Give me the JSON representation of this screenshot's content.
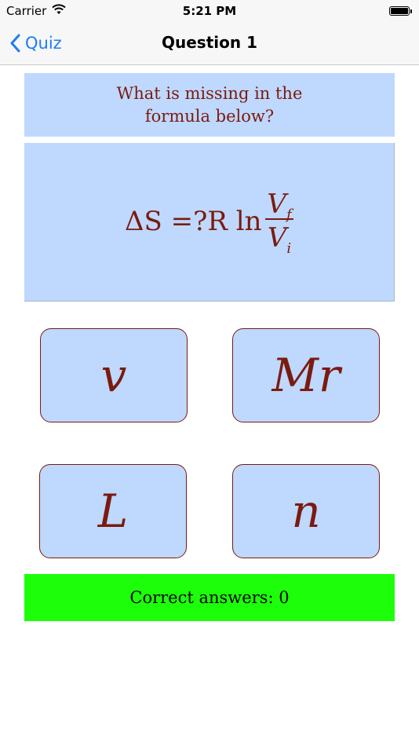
{
  "status_bar": {
    "carrier": "Carrier",
    "time": "5:21 PM",
    "wifi_icon": "wifi-icon",
    "battery_icon": "battery-icon"
  },
  "nav_bar": {
    "back_label": "Quiz",
    "back_icon": "chevron-left-icon",
    "title": "Question 1"
  },
  "question": {
    "text": "What is missing in the formula below?"
  },
  "formula": {
    "lhs": "ΔS =?R ln",
    "numerator": "V",
    "numerator_sub": "f",
    "denominator": "V",
    "denominator_sub": "i"
  },
  "answers": [
    {
      "label": "v"
    },
    {
      "label": "Mr"
    },
    {
      "label": "L"
    },
    {
      "label": "n"
    }
  ],
  "score": {
    "text": "Correct answers: 0"
  },
  "colors": {
    "card_bg": "#bfd8fd",
    "text": "#7a1b10",
    "score_bg": "#1dff0a",
    "link": "#1e7cf5"
  }
}
